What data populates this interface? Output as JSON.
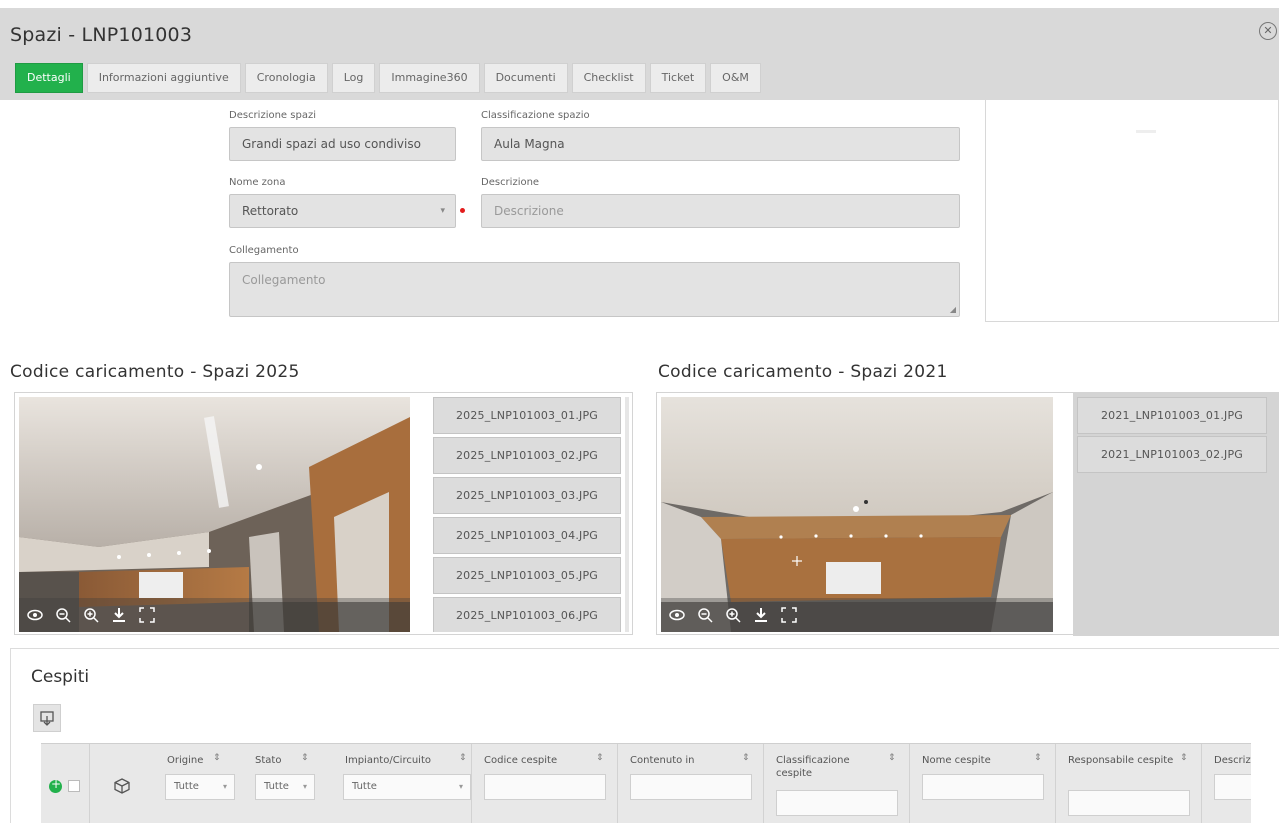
{
  "window": {
    "title": "Spazi - LNP101003"
  },
  "tabs": [
    {
      "label": "Dettagli",
      "active": true
    },
    {
      "label": "Informazioni aggiuntive"
    },
    {
      "label": "Cronologia"
    },
    {
      "label": "Log"
    },
    {
      "label": "Immagine360"
    },
    {
      "label": "Documenti"
    },
    {
      "label": "Checklist"
    },
    {
      "label": "Ticket"
    },
    {
      "label": "O&M"
    }
  ],
  "form": {
    "descrizione_spazi": {
      "label": "Descrizione spazi",
      "value": "Grandi spazi ad uso condiviso"
    },
    "classificazione_spazio": {
      "label": "Classificazione spazio",
      "value": "Aula Magna"
    },
    "nome_zona": {
      "label": "Nome zona",
      "value": "Rettorato"
    },
    "descrizione": {
      "label": "Descrizione",
      "placeholder": "Descrizione"
    },
    "collegamento": {
      "label": "Collegamento",
      "placeholder": "Collegamento"
    }
  },
  "gallery_2025": {
    "title": "Codice caricamento - Spazi 2025",
    "files": [
      "2025_LNP101003_01.JPG",
      "2025_LNP101003_02.JPG",
      "2025_LNP101003_03.JPG",
      "2025_LNP101003_04.JPG",
      "2025_LNP101003_05.JPG",
      "2025_LNP101003_06.JPG"
    ]
  },
  "gallery_2021": {
    "title": "Codice caricamento - Spazi 2021",
    "files": [
      "2021_LNP101003_01.JPG",
      "2021_LNP101003_02.JPG"
    ]
  },
  "cespiti": {
    "title": "Cespiti",
    "columns": {
      "origine": {
        "label": "Origine",
        "filter": "Tutte"
      },
      "stato": {
        "label": "Stato",
        "filter": "Tutte"
      },
      "impianto": {
        "label": "Impianto/Circuito",
        "filter": "Tutte"
      },
      "codice": {
        "label": "Codice cespite"
      },
      "contenuto": {
        "label": "Contenuto in"
      },
      "classificazione": {
        "label": "Classificazione cespite"
      },
      "nome": {
        "label": "Nome cespite"
      },
      "responsabile": {
        "label": "Responsabile cespite"
      },
      "descrizione": {
        "label": "Descrizi"
      }
    }
  },
  "icons": [
    "close-icon",
    "eye-icon",
    "zoom-out-icon",
    "zoom-in-icon",
    "download-icon",
    "fullscreen-icon",
    "export-icon",
    "cube-icon",
    "plus-icon",
    "sort-icon",
    "chevron-down-icon"
  ],
  "colors": {
    "accent": "#22b14c",
    "required": "#e31c1c",
    "header_bg": "#d9d9d9"
  }
}
